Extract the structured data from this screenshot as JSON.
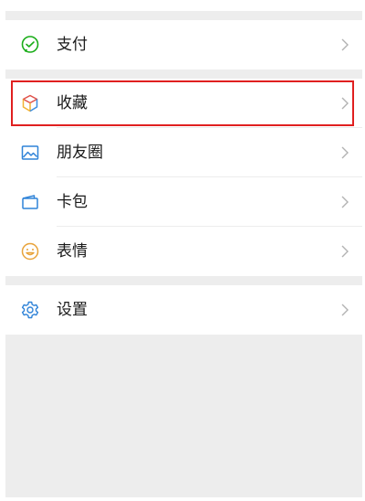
{
  "menu": {
    "pay": {
      "label": "支付",
      "icon": "wechat-pay-icon"
    },
    "favorites": {
      "label": "收藏",
      "icon": "cube-icon"
    },
    "moments": {
      "label": "朋友圈",
      "icon": "image-icon"
    },
    "cards": {
      "label": "卡包",
      "icon": "card-wallet-icon"
    },
    "stickers": {
      "label": "表情",
      "icon": "smiley-icon"
    },
    "settings": {
      "label": "设置",
      "icon": "gear-icon"
    }
  },
  "colors": {
    "pay_green": "#1aad19",
    "moments_blue": "#2f83d8",
    "cards_blue": "#2f83d8",
    "stickers_orange": "#e8a33a",
    "settings_blue": "#2f83d8",
    "highlight_red": "#e02020",
    "background_gray": "#ededed"
  }
}
